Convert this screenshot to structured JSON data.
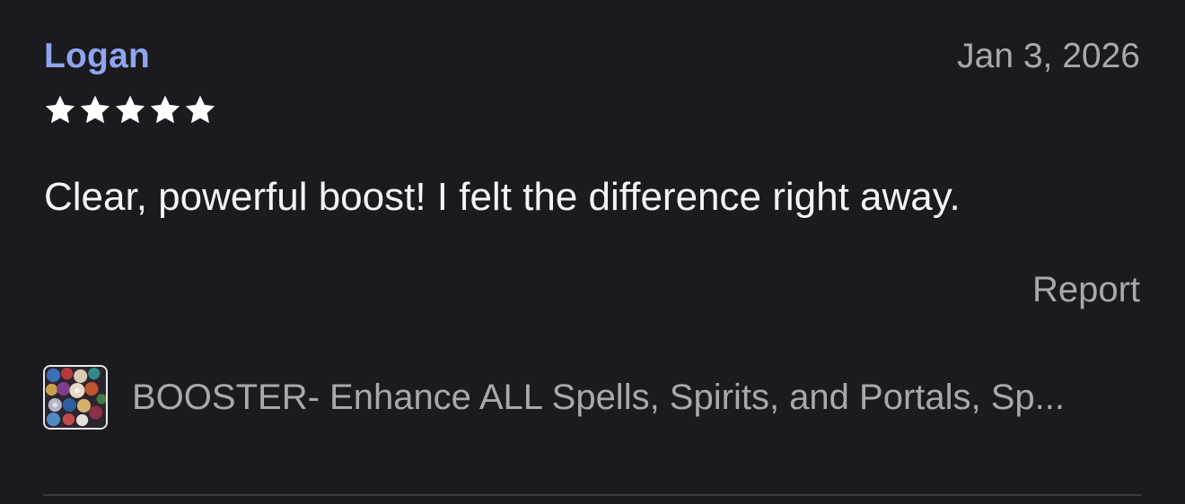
{
  "review": {
    "reviewer": "Logan",
    "date": "Jan 3, 2026",
    "rating": 5,
    "rating_max": 5,
    "text": "Clear, powerful boost! I felt the difference right away.",
    "report_label": "Report",
    "product": {
      "title": "BOOSTER- Enhance ALL Spells, Spirits, and Portals, Sp...",
      "thumbnail_icon": "product-thumbnail-icon"
    }
  },
  "colors": {
    "background": "#1b1a1e",
    "reviewer_name": "#8ea6f0",
    "secondary_text": "#a9a8ad",
    "primary_text": "#f4f4f6",
    "star": "#ffffff",
    "divider": "#3a393e"
  }
}
